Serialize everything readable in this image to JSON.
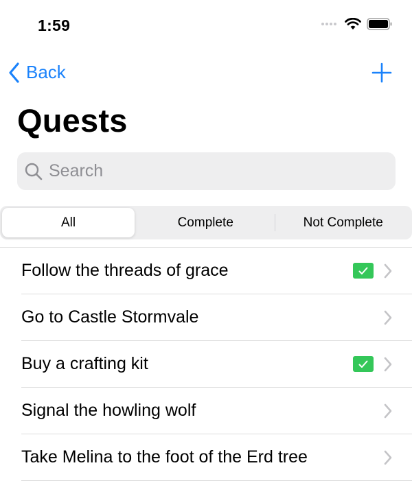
{
  "status_bar": {
    "time": "1:59",
    "icons": [
      "signal-dots-icon",
      "wifi-icon",
      "battery-icon"
    ]
  },
  "nav": {
    "back_label": "Back",
    "back_icon": "chevron-left-icon",
    "add_icon": "plus-icon",
    "accent_color": "#1a82fb"
  },
  "page": {
    "title": "Quests"
  },
  "search": {
    "placeholder": "Search",
    "value": "",
    "icon": "search-icon"
  },
  "filter": {
    "segments": [
      {
        "label": "All",
        "selected": true
      },
      {
        "label": "Complete",
        "selected": false
      },
      {
        "label": "Not Complete",
        "selected": false
      }
    ]
  },
  "quests": [
    {
      "title": "Follow the threads of grace",
      "complete": true
    },
    {
      "title": "Go to Castle Stormvale",
      "complete": false
    },
    {
      "title": "Buy a crafting kit",
      "complete": true
    },
    {
      "title": "Signal the howling wolf",
      "complete": false
    },
    {
      "title": "Take Melina to the foot of the Erd tree",
      "complete": false
    }
  ],
  "colors": {
    "complete_badge": "#34c759",
    "chevron": "#c4c4c7"
  }
}
